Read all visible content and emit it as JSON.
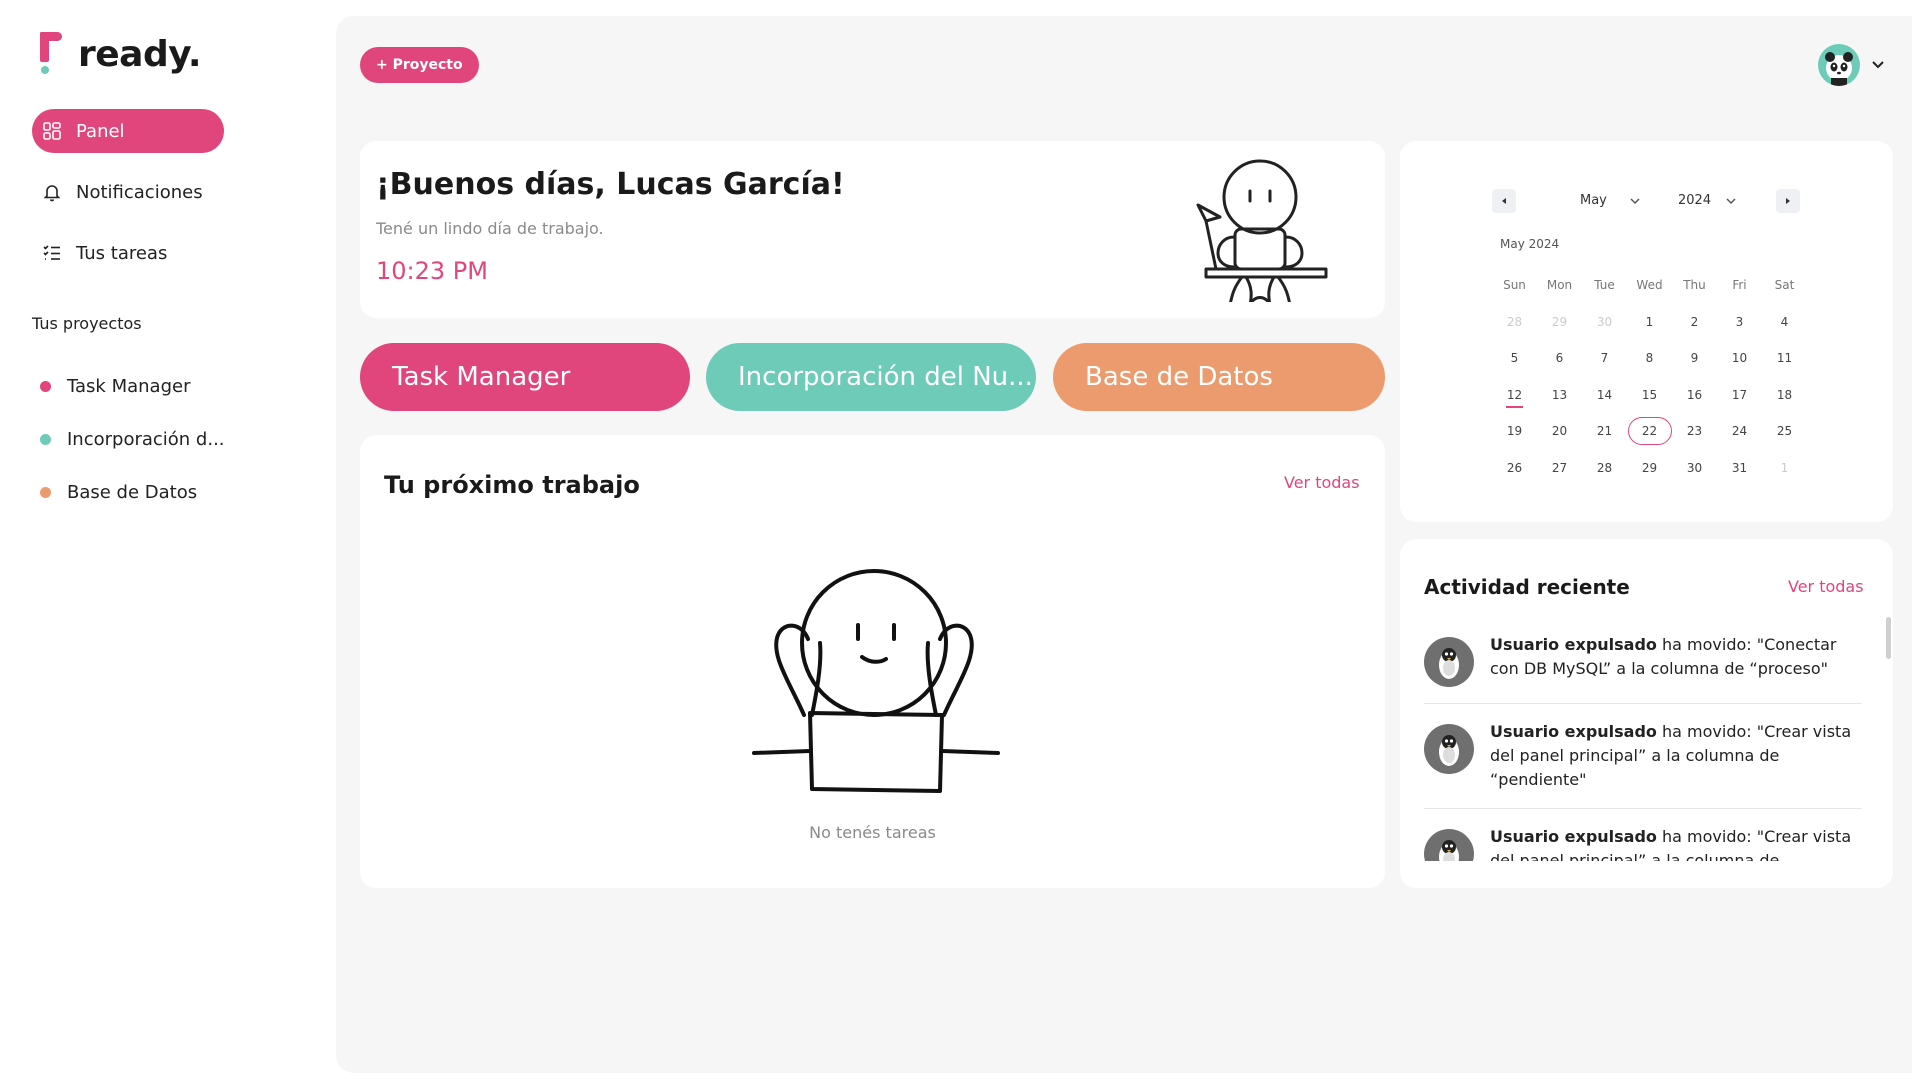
{
  "app": {
    "logo_text": "ready."
  },
  "colors": {
    "accent": "#e0457b",
    "teal": "#6dcbb8",
    "orange": "#ec9b6f",
    "background": "#f6f6f6"
  },
  "sidebar": {
    "nav": [
      {
        "label": "Panel",
        "icon": "dashboard-icon",
        "active": true
      },
      {
        "label": "Notificaciones",
        "icon": "bell-icon",
        "active": false
      },
      {
        "label": "Tus tareas",
        "icon": "task-list-icon",
        "active": false
      }
    ],
    "projects_title": "Tus proyectos",
    "projects": [
      {
        "label": "Task Manager",
        "color": "#e0457b"
      },
      {
        "label": "Incorporación d...",
        "color": "#6dcbb8"
      },
      {
        "label": "Base de Datos",
        "color": "#ec9b6f"
      }
    ]
  },
  "header": {
    "add_project_label": "+ Proyecto",
    "avatar_icon": "panda-avatar-icon"
  },
  "greeting": {
    "title": "¡Buenos días, Lucas García!",
    "subtitle": "Tené un lindo día de trabajo.",
    "time": "10:23 PM"
  },
  "project_pills": [
    {
      "label": "Task Manager",
      "color": "#e0457b"
    },
    {
      "label": "Incorporación del Nu...",
      "color": "#6dcbb8"
    },
    {
      "label": "Base de Datos",
      "color": "#ec9b6f"
    }
  ],
  "next_work": {
    "title": "Tu próximo trabajo",
    "see_all": "Ver todas",
    "empty_text": "No tenés tareas"
  },
  "calendar": {
    "month_select": "May",
    "year_select": "2024",
    "caption": "May 2024",
    "weekdays": [
      "Sun",
      "Mon",
      "Tue",
      "Wed",
      "Thu",
      "Fri",
      "Sat"
    ],
    "weeks": [
      [
        "28",
        "29",
        "30",
        "1",
        "2",
        "3",
        "4"
      ],
      [
        "5",
        "6",
        "7",
        "8",
        "9",
        "10",
        "11"
      ],
      [
        "12",
        "13",
        "14",
        "15",
        "16",
        "17",
        "18"
      ],
      [
        "19",
        "20",
        "21",
        "22",
        "23",
        "24",
        "25"
      ],
      [
        "26",
        "27",
        "28",
        "29",
        "30",
        "31",
        "1"
      ]
    ],
    "outside_days": [
      "0-0",
      "0-1",
      "0-2",
      "4-6"
    ],
    "today": "2-0",
    "selected": "3-3"
  },
  "activity": {
    "title": "Actividad reciente",
    "see_all": "Ver todas",
    "items": [
      {
        "user": "Usuario expulsado",
        "text": " ha movido: \"Conectar con DB MySQL” a la columna de “proceso\""
      },
      {
        "user": "Usuario expulsado",
        "text": " ha movido: \"Crear vista del panel principal” a la columna de “pendiente\""
      },
      {
        "user": "Usuario expulsado",
        "text": " ha movido: \"Crear vista del panel principal” a la columna de “completado\""
      }
    ]
  }
}
